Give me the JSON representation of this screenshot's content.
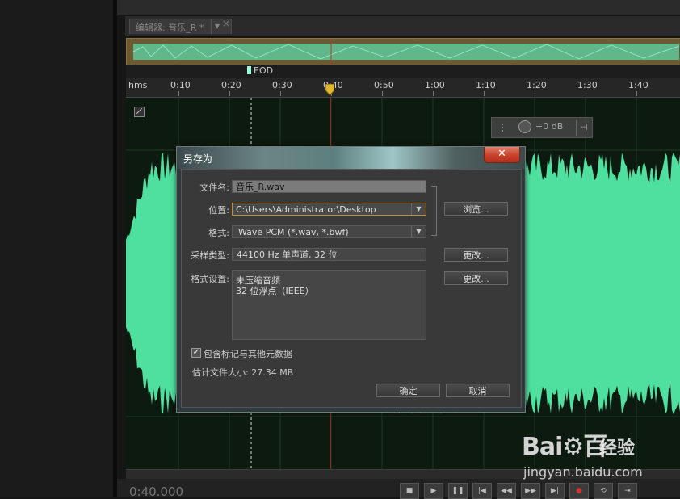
{
  "editor": {
    "tab_title": "编辑器: 音乐_R *",
    "tab_dropdown": "▼",
    "tab_close": "×",
    "eod_label": "EOD",
    "timecode": "0:40.000",
    "volume_hud": "+0 dB",
    "ruler_labels": [
      "hms",
      "0:10",
      "0:20",
      "0:30",
      "0:40",
      "0:50",
      "1:00",
      "1:10",
      "1:20",
      "1:30",
      "1:40"
    ],
    "transport_icons": [
      "stop-icon",
      "play-icon",
      "pause-icon",
      "skip-start-icon",
      "rewind-icon",
      "fast-forward-icon",
      "skip-end-icon",
      "record-icon",
      "loop-icon",
      "skip-selection-icon"
    ],
    "wave_color": "#4fe0a0",
    "overview_color": "#6b5a32",
    "playhead_color": "#c33333"
  },
  "dialog": {
    "title": "另存为",
    "close_label": "✕",
    "filename_label": "文件名:",
    "filename_value": "音乐_R.wav",
    "location_label": "位置:",
    "location_value": "C:\\Users\\Administrator\\Desktop",
    "browse_button": "浏览...",
    "format_label": "格式:",
    "format_value": "Wave PCM (*.wav, *.bwf)",
    "sample_type_label": "采样类型:",
    "sample_type_value": "44100 Hz 单声道, 32 位",
    "sample_change_button": "更改...",
    "format_settings_label": "格式设置:",
    "format_settings_line1": "未压缩音频",
    "format_settings_line2": "32 位浮点（IEEE）",
    "format_change_button": "更改...",
    "include_markers_label": "包含标记与其他元数据",
    "include_markers_checked": true,
    "estimated_size": "估计文件大小: 27.34 MB",
    "ok_button": "确定",
    "cancel_button": "取消"
  },
  "watermark": {
    "logo": "Bai⚙百",
    "jingyan": "经验",
    "url": "jingyan.baidu.com"
  }
}
